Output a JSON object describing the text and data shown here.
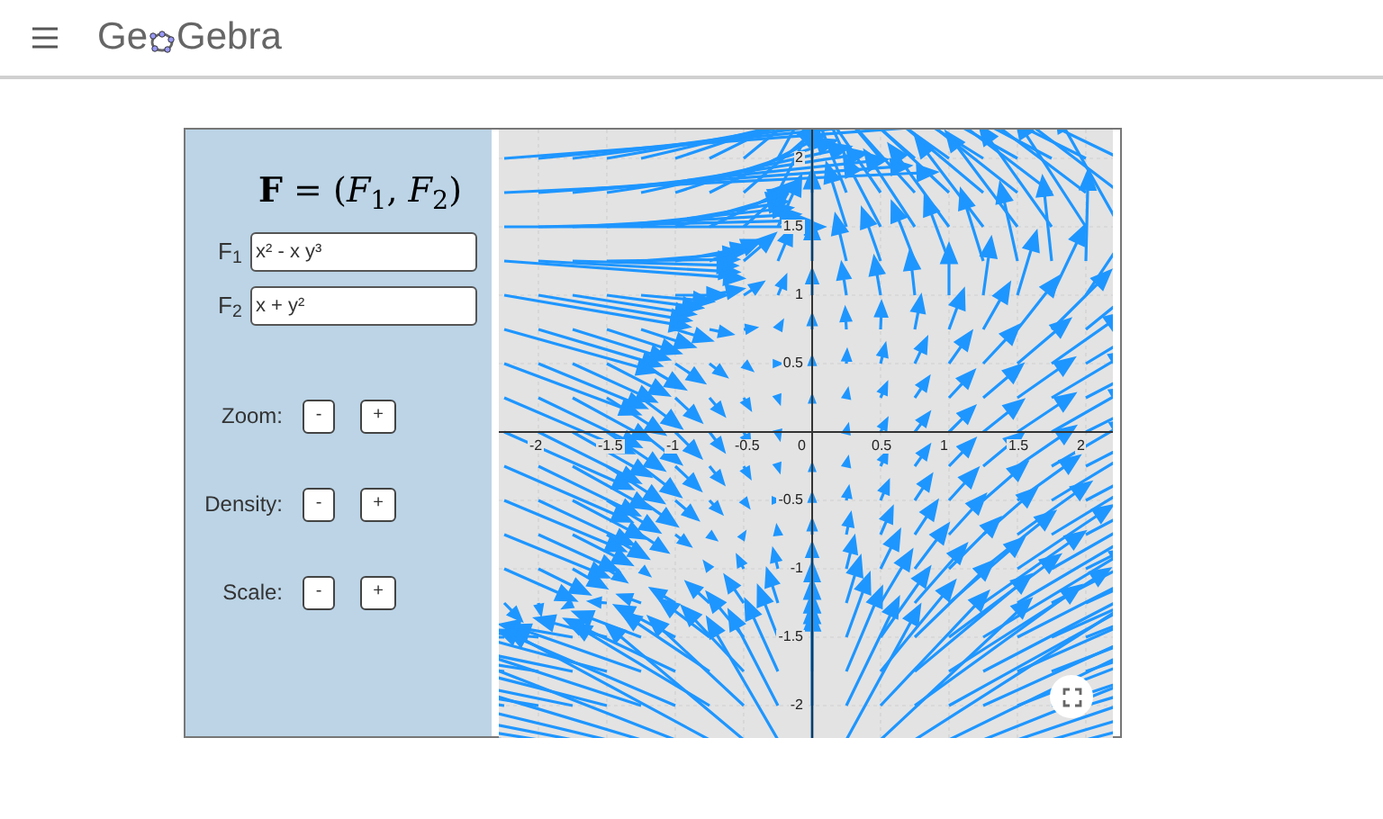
{
  "header": {
    "logo_start": "Ge",
    "logo_end": "Gebra"
  },
  "panel": {
    "formula": "**F** = (*F*$_{1}$, *F*$_{2}$)",
    "fields": [
      {
        "label": "F$_{1}$",
        "value": "x² - x y³"
      },
      {
        "label": "F$_{2}$",
        "value": "x + y²"
      }
    ],
    "controls": [
      {
        "label": "Zoom:",
        "minus": "-",
        "plus": "+"
      },
      {
        "label": "Density:",
        "minus": "-",
        "plus": "+"
      },
      {
        "label": "Scale:",
        "minus": "-",
        "plus": "+"
      }
    ]
  },
  "graph": {
    "x_ticks": [
      "-2",
      "-1.5",
      "-1",
      "-0.5",
      "0",
      "0.5",
      "1",
      "1.5",
      "2"
    ],
    "y_ticks": [
      "2",
      "1.5",
      "1",
      "0.5",
      "-0.5",
      "-1",
      "-1.5",
      "-2"
    ]
  }
}
